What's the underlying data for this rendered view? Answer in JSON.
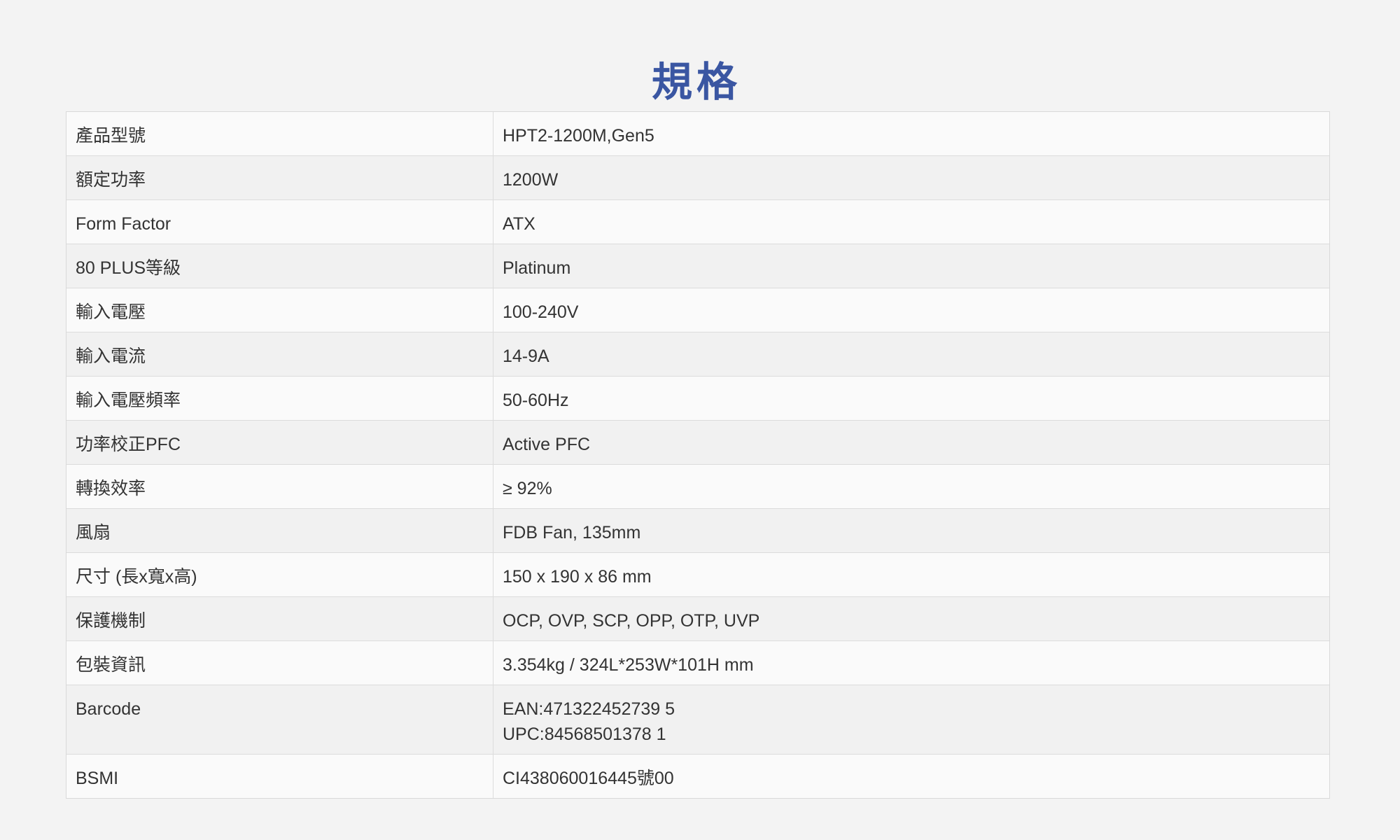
{
  "page": {
    "title": "規格",
    "title_color": "#3a56a2",
    "text_color": "#333333",
    "background": "#f3f3f3"
  },
  "specs": [
    {
      "label": "產品型號",
      "value": [
        "HPT2-1200M,Gen5"
      ]
    },
    {
      "label": "額定功率",
      "value": [
        "1200W"
      ]
    },
    {
      "label": "Form Factor",
      "value": [
        "ATX"
      ]
    },
    {
      "label": "80 PLUS等級",
      "value": [
        "Platinum"
      ]
    },
    {
      "label": "輸入電壓",
      "value": [
        "100-240V"
      ]
    },
    {
      "label": "輸入電流",
      "value": [
        "14-9A"
      ]
    },
    {
      "label": "輸入電壓頻率",
      "value": [
        "50-60Hz"
      ]
    },
    {
      "label": "功率校正PFC",
      "value": [
        "Active PFC"
      ]
    },
    {
      "label": "轉換效率",
      "value": [
        "≥ 92%"
      ]
    },
    {
      "label": "風扇",
      "value": [
        "FDB Fan, 135mm"
      ]
    },
    {
      "label": "尺寸 (長x寬x高)",
      "value": [
        "150 x 190 x 86 mm"
      ]
    },
    {
      "label": "保護機制",
      "value": [
        "OCP, OVP, SCP, OPP, OTP, UVP"
      ]
    },
    {
      "label": "包裝資訊",
      "value": [
        "3.354kg / 324L*253W*101H mm"
      ]
    },
    {
      "label": "Barcode",
      "value": [
        "EAN:471322452739 5",
        "UPC:84568501378 1"
      ]
    },
    {
      "label": "BSMI",
      "value": [
        "CI438060016445號00"
      ]
    }
  ]
}
